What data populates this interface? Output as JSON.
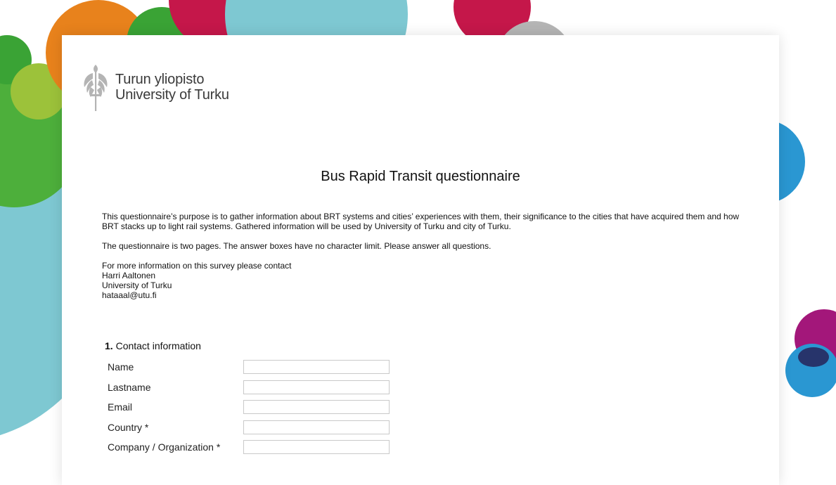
{
  "brand": {
    "name_fi": "Turun yliopisto",
    "name_en": "University of Turku"
  },
  "survey": {
    "title": "Bus Rapid Transit questionnaire",
    "intro_paragraph_1": "This questionnaire’s purpose is to gather information about BRT systems and cities’ experiences with them, their significance to the cities that have acquired them and how BRT stacks up to light rail systems. Gathered information will be used by University of Turku and city of Turku.",
    "intro_paragraph_2": "The questionnaire is two pages. The answer boxes have no character limit. Please answer all questions.",
    "contact_intro": "For more information on this survey please contact",
    "contact_name": "Harri Aaltonen",
    "contact_org": "University of Turku",
    "contact_email": "hataaal@utu.fi"
  },
  "section": {
    "number": "1.",
    "title": "Contact information",
    "fields": [
      {
        "label": "Name",
        "value": ""
      },
      {
        "label": "Lastname",
        "value": ""
      },
      {
        "label": "Email",
        "value": ""
      },
      {
        "label": "Country *",
        "value": ""
      },
      {
        "label": "Company / Organization *",
        "value": ""
      }
    ]
  },
  "colors": {
    "orange": "#e8821c",
    "green": "#3aa335",
    "lime": "#9cc23a",
    "crimson": "#c5174a",
    "teal": "#7ec8d2",
    "blue": "#2a97d2",
    "purple": "#a3177a",
    "navy": "#27346b",
    "grey": "#b5b5b5"
  }
}
